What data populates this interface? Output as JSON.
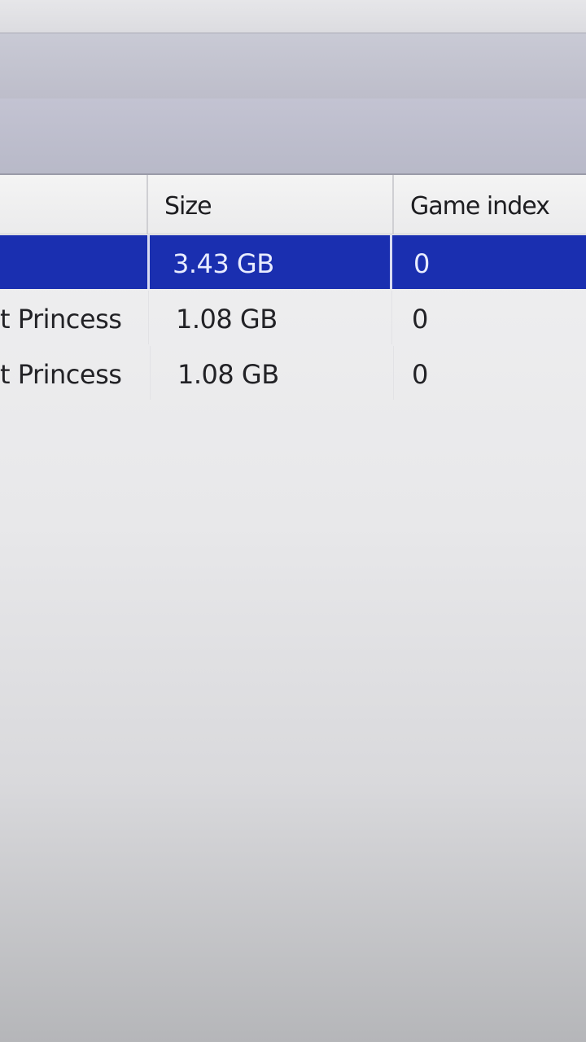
{
  "columns": {
    "size": "Size",
    "game_index": "Game index"
  },
  "rows": [
    {
      "name": "",
      "size": "3.43 GB",
      "game_index": "0",
      "selected": true
    },
    {
      "name": "t Princess",
      "size": "1.08 GB",
      "game_index": "0",
      "selected": false
    },
    {
      "name": "t Princess",
      "size": "1.08 GB",
      "game_index": "0",
      "selected": false
    }
  ],
  "colors": {
    "selection": "#1a2fb0",
    "toolbar": "#c3c3d2",
    "list_background": "#eeeeef"
  }
}
